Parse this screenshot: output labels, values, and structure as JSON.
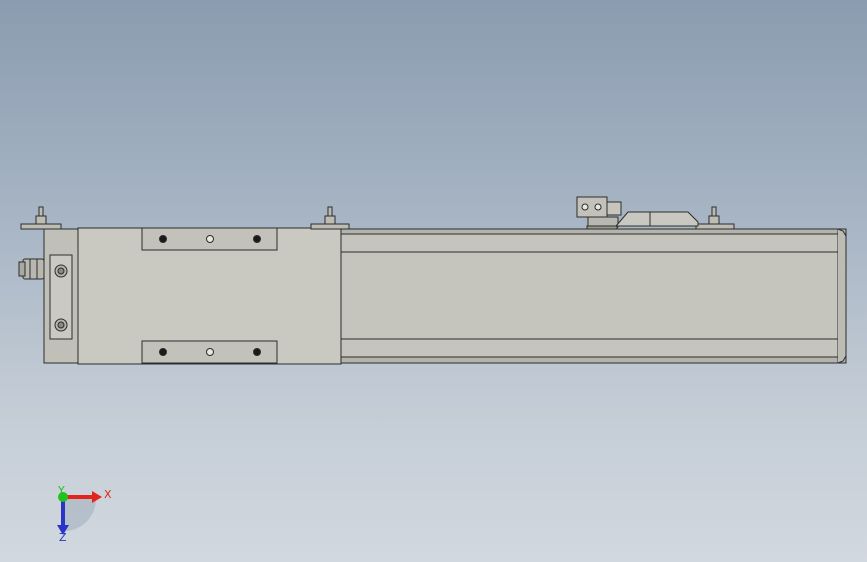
{
  "viewport": {
    "background_top": "#8b9cb0",
    "background_bottom": "#d2d8df"
  },
  "model": {
    "body_color": "#c5c5bd",
    "edge_color": "#2c2c2c",
    "slider_color": "#c9c9c2",
    "bracket_color": "#bdbdb5"
  },
  "triad": {
    "x_label": "X",
    "y_label": "Y",
    "z_label": "Z",
    "x_color": "#e0261c",
    "y_color": "#1fc21f",
    "z_color": "#2a35c8"
  }
}
